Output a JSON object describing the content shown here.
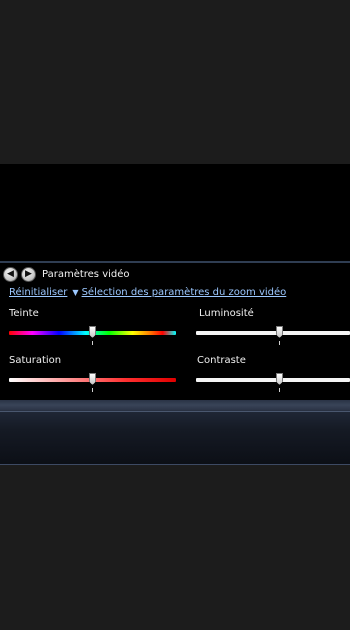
{
  "panel": {
    "title": "Paramètres vidéo",
    "reset_link": "Réinitialiser",
    "zoom_link": "Sélection des paramètres du zoom vidéo"
  },
  "sliders": {
    "hue": {
      "label": "Teinte",
      "value": 0.5
    },
    "brightness": {
      "label": "Luminosité",
      "value": 0.5
    },
    "saturation": {
      "label": "Saturation",
      "value": 0.5
    },
    "contrast": {
      "label": "Contraste",
      "value": 0.5
    }
  },
  "icons": {
    "prev": "back-arrow-icon",
    "next": "forward-arrow-icon",
    "dropdown": "caret-down-icon"
  }
}
